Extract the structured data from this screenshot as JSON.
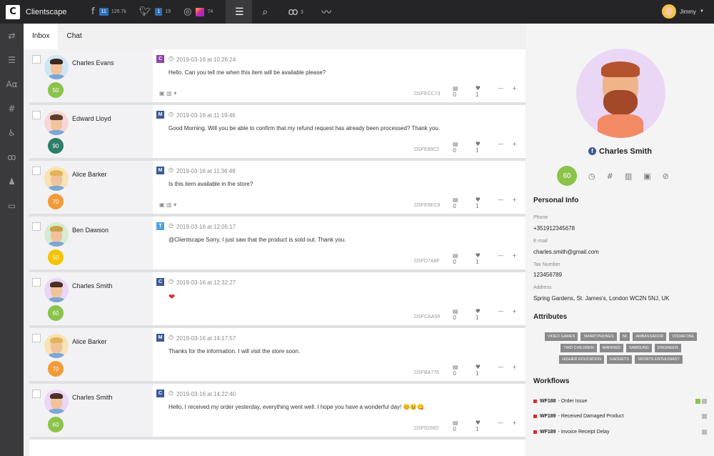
{
  "app": {
    "name": "Clientscape"
  },
  "social": {
    "fb_count": "11",
    "fb_followers": "126.7k",
    "tw_count": "1",
    "tw_followers": "19",
    "ig_followers": "74"
  },
  "nav": {
    "flows_count": "3"
  },
  "user": {
    "name": "Jimmy"
  },
  "tabs": [
    {
      "label": "Inbox"
    },
    {
      "label": "Chat"
    }
  ],
  "messages": [
    {
      "name": "Charles Evans",
      "score": "50",
      "score_color": "#8bc34a",
      "channel": "C",
      "channel_color": "#8e44ad",
      "date": "2019-03-16 at 10:26:24",
      "text": "Hello. Can you tell me when this item will be available please?",
      "code": "DSFECC73",
      "likes": "1",
      "comments": "0"
    },
    {
      "name": "Edward Lloyd",
      "score": "90",
      "score_color": "#2e7d6b",
      "channel": "M",
      "channel_color": "#3b5998",
      "date": "2019-03-16 at 11:19:46",
      "text": "Good Morning. Will you be able to confirm that my refund request has already been processed? Thank you.",
      "code": "DSFE89C2",
      "likes": "1",
      "comments": "0"
    },
    {
      "name": "Alice Barker",
      "score": "70",
      "score_color": "#f29a38",
      "channel": "M",
      "channel_color": "#3b5998",
      "date": "2019-03-16 at 11:36:48",
      "text": "Is this item available in the store?",
      "code": "DSFE6EC9",
      "likes": "1",
      "comments": "0"
    },
    {
      "name": "Ben Dawson",
      "score": "50",
      "score_color": "#f5c400",
      "channel": "T",
      "channel_color": "#4ba3e2",
      "date": "2019-03-16 at 12:05:17",
      "text": "@Clientscape Sorry, I just saw that the product is sold out. Thank you.",
      "code": "DSFD7A8F",
      "likes": "1",
      "comments": "0"
    },
    {
      "name": "Charles Smith",
      "score": "60",
      "score_color": "#8bc34a",
      "channel": "C",
      "channel_color": "#3b5998",
      "date": "2019-03-16 at 12:32:27",
      "text": "❤",
      "code": "DSFCAA59",
      "likes": "1",
      "comments": "0"
    },
    {
      "name": "Alice Barker",
      "score": "70",
      "score_color": "#f29a38",
      "channel": "M",
      "channel_color": "#3b5998",
      "date": "2019-03-16 at 14:17:57",
      "text": "Thanks for the information. I will visit the store soon.",
      "code": "DSFBA776",
      "likes": "1",
      "comments": "0"
    },
    {
      "name": "Charles Smith",
      "score": "60",
      "score_color": "#8bc34a",
      "channel": "C",
      "channel_color": "#3b5998",
      "date": "2019-03-16 at 14:22:40",
      "text": "Hello, I received my order yesterday, everything went well. I hope you have a wonderful day! 😊😉😋",
      "code": "DSF9209D",
      "likes": "1",
      "comments": "0"
    }
  ],
  "profile": {
    "name": "Charles Smith",
    "score": "60",
    "personal_info_title": "Personal Info",
    "phone_label": "Phone",
    "phone": "+351912345678",
    "email_label": "E-mail",
    "email": "charles.smith@gmail.com",
    "tax_label": "Tax Number",
    "tax": "123456789",
    "address_label": "Address",
    "address": "Spring Gardens, St. James's, London WC2N 5NJ, UK",
    "attributes_title": "Attributes",
    "attributes": [
      "VIDEO GAMES",
      "SMARTPHONES",
      "5K",
      "AMBASSADOR",
      "VODAFONE",
      "TWO CHILDREN",
      "MARRIED",
      "SAMSUNG",
      "ENGINEER",
      "HIGHER EDUCATION",
      "GADGETS",
      "SPORTS ENTHUSIAST"
    ],
    "workflows_title": "Workflows",
    "workflows": [
      {
        "id": "WF188",
        "title": " - Order Issue"
      },
      {
        "id": "WF189",
        "title": " - Received Damaged Product"
      },
      {
        "id": "WF189",
        "title": " - Invoice Receipt Delay"
      }
    ]
  }
}
